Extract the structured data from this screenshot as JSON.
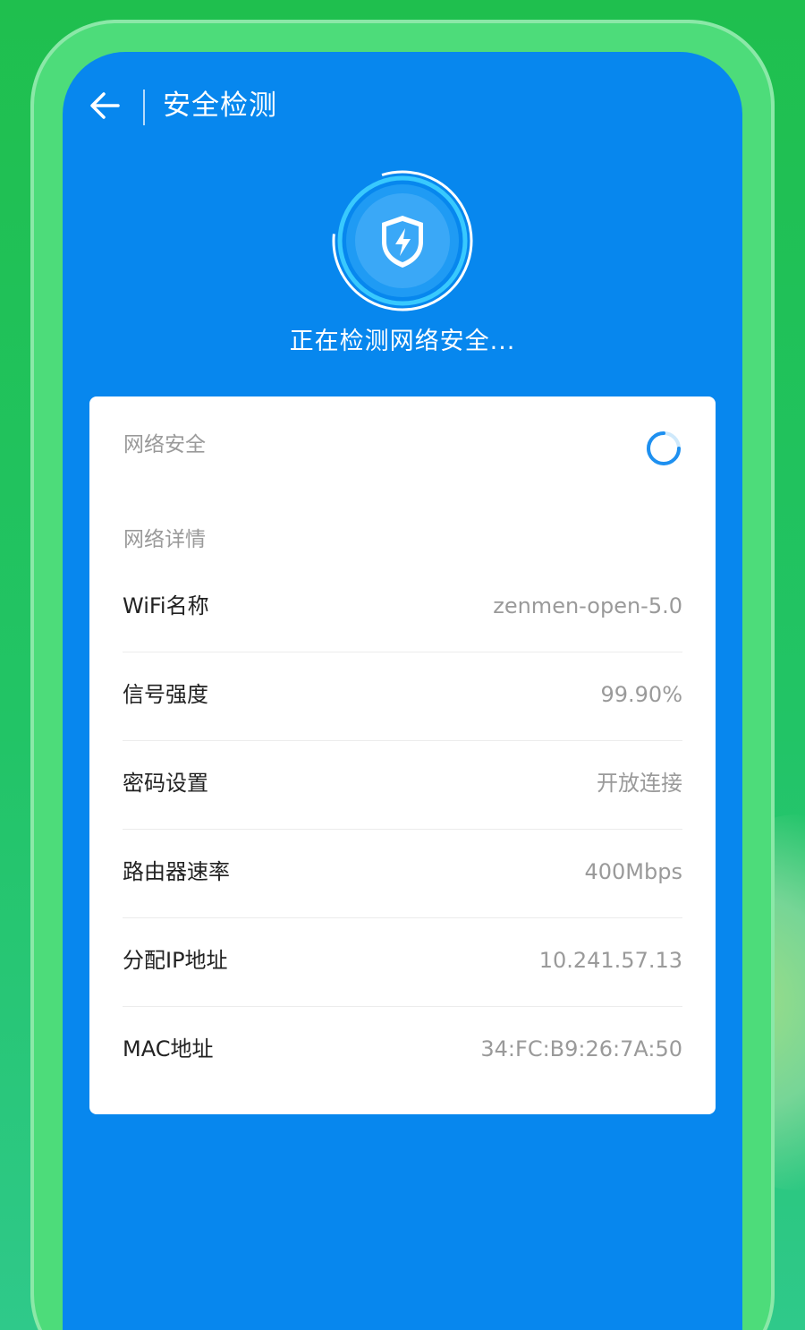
{
  "header": {
    "back_icon": "arrow-left-icon",
    "title": "安全检测"
  },
  "scanner": {
    "icon": "shield-bolt-icon",
    "status": "正在检测网络安全..."
  },
  "card": {
    "security_section": {
      "label": "网络安全",
      "loading_icon": "spinner-icon"
    },
    "details_section": {
      "label": "网络详情",
      "rows": [
        {
          "label": "WiFi名称",
          "value": "zenmen-open-5.0"
        },
        {
          "label": "信号强度",
          "value": "99.90%"
        },
        {
          "label": "密码设置",
          "value": "开放连接"
        },
        {
          "label": "路由器速率",
          "value": "400Mbps"
        },
        {
          "label": "分配IP地址",
          "value": "10.241.57.13"
        },
        {
          "label": "MAC地址",
          "value": "34:FC:B9:26:7A:50"
        }
      ]
    }
  },
  "colors": {
    "screen_blue": "#0787ee",
    "background_green": "#22c466",
    "frame_green": "#4ddc7a",
    "scanner_cyan": "#3ed0ff",
    "spinner_blue": "#1e90f0"
  }
}
